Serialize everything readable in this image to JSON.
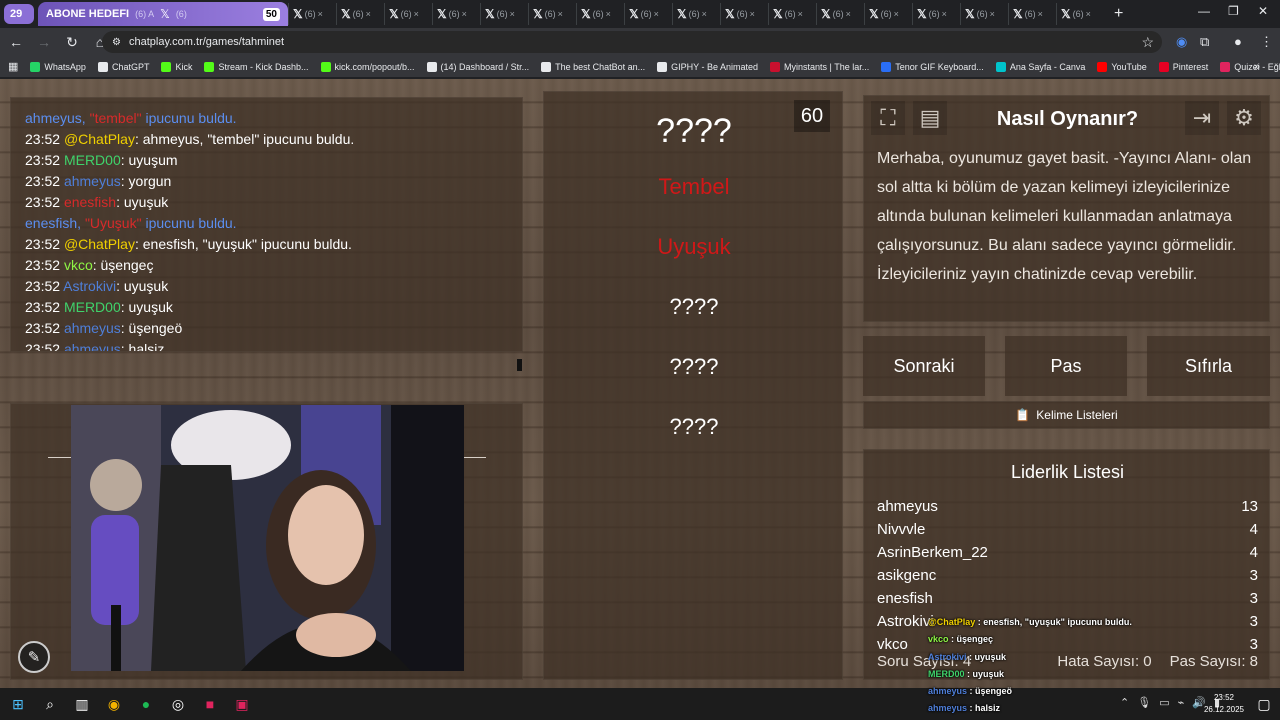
{
  "browser": {
    "tab_count": "29",
    "active_tab": {
      "title": "ABONE HEDEFI",
      "subtitle": "(6) A",
      "number": "50"
    },
    "other_tabs_label": "(6)",
    "other_tabs_count": 17,
    "url": "chatplay.com.tr/games/tahminet",
    "bookmarks": [
      {
        "label": "WhatsApp",
        "color": "#25d366"
      },
      {
        "label": "ChatGPT",
        "color": "#e8eaed"
      },
      {
        "label": "Kick",
        "color": "#53fc18"
      },
      {
        "label": "Stream - Kick Dashb...",
        "color": "#53fc18"
      },
      {
        "label": "kick.com/popout/b...",
        "color": "#53fc18"
      },
      {
        "label": "(14) Dashboard / Str...",
        "color": "#e8eaed"
      },
      {
        "label": "The best ChatBot an...",
        "color": "#e8eaed"
      },
      {
        "label": "GIPHY - Be Animated",
        "color": "#e8eaed"
      },
      {
        "label": "Myinstants | The lar...",
        "color": "#c8102e"
      },
      {
        "label": "Tenor GIF Keyboard...",
        "color": "#2a6ef5"
      },
      {
        "label": "Ana Sayfa - Canva",
        "color": "#00c4cc"
      },
      {
        "label": "YouTube",
        "color": "#ff0000"
      },
      {
        "label": "Pinterest",
        "color": "#e60023"
      },
      {
        "label": "Quizei - Eğlenceli ve...",
        "color": "#e0245e"
      }
    ]
  },
  "chat": {
    "lines": [
      {
        "type": "system",
        "pre": "ahmeyus, ",
        "hl": "\"tembel\"",
        "post": " ipucunu buldu."
      },
      {
        "type": "msg",
        "time": "23:52",
        "user": "@ChatPlay",
        "color": "#f0d000",
        "text": ": ahmeyus, \"tembel\" ipucunu buldu."
      },
      {
        "type": "msg",
        "time": "23:52",
        "user": "MERD00",
        "color": "#3fd36b",
        "text": ": uyuşum"
      },
      {
        "type": "msg",
        "time": "23:52",
        "user": "ahmeyus",
        "color": "#4f7fd9",
        "text": ": yorgun"
      },
      {
        "type": "msg",
        "time": "23:52",
        "user": "enesfish",
        "color": "#d72a2a",
        "text": ": uyuşuk"
      },
      {
        "type": "system",
        "pre": "enesfish, ",
        "hl": "\"Uyuşuk\"",
        "post": " ipucunu buldu."
      },
      {
        "type": "msg",
        "time": "23:52",
        "user": "@ChatPlay",
        "color": "#f0d000",
        "text": ": enesfish, \"uyuşuk\" ipucunu buldu."
      },
      {
        "type": "msg",
        "time": "23:52",
        "user": "vkco",
        "color": "#8ef545",
        "text": ": üşengeç"
      },
      {
        "type": "msg",
        "time": "23:52",
        "user": "Astrokivi",
        "color": "#4f7fd9",
        "text": ": uyuşuk"
      },
      {
        "type": "msg",
        "time": "23:52",
        "user": "MERD00",
        "color": "#3fd36b",
        "text": ": uyuşuk"
      },
      {
        "type": "msg",
        "time": "23:52",
        "user": "ahmeyus",
        "color": "#4f7fd9",
        "text": ": üşengeö"
      },
      {
        "type": "msg",
        "time": "23:52",
        "user": "ahmeyus",
        "color": "#4f7fd9",
        "text": ": halsiz"
      }
    ]
  },
  "game": {
    "timer": "60",
    "words": [
      {
        "text": "????",
        "state": "hidden",
        "big": true
      },
      {
        "text": "Tembel",
        "state": "found",
        "big": false
      },
      {
        "text": "Uyuşuk",
        "state": "found",
        "big": false
      },
      {
        "text": "????",
        "state": "hidden",
        "big": false
      },
      {
        "text": "????",
        "state": "hidden",
        "big": false
      },
      {
        "text": "????",
        "state": "hidden",
        "big": false
      }
    ]
  },
  "howto": {
    "title": "Nasıl Oynanır?",
    "text": "Merhaba, oyunumuz gayet basit. -Yayıncı Alanı- olan sol altta ki bölüm de yazan kelimeyi izleyicilerinize altında bulunan kelimeleri kullanmadan anlatmaya çalışıyorsunuz. Bu alanı sadece yayıncı görmelidir. İzleyicileriniz yayın chatinizde cevap verebilir."
  },
  "buttons": {
    "next": "Sonraki",
    "pass": "Pas",
    "reset": "Sıfırla",
    "word_lists": "Kelime Listeleri"
  },
  "leaderboard": {
    "title": "Liderlik Listesi",
    "rows": [
      {
        "name": "ahmeyus",
        "score": "13"
      },
      {
        "name": "Nivvvle",
        "score": "4"
      },
      {
        "name": "AsrinBerkem_22",
        "score": "4"
      },
      {
        "name": "asikgenc",
        "score": "3"
      },
      {
        "name": "enesfish",
        "score": "3"
      },
      {
        "name": "Astrokivi",
        "score": "3"
      },
      {
        "name": "vkco",
        "score": "3"
      }
    ],
    "question_count": "Soru Sayısı: 4",
    "error_count": "Hata Sayısı: 0",
    "pass_count": "Pas Sayısı: 8"
  },
  "overlay_chat": [
    {
      "user": "@ChatPlay",
      "color": "#f0d000",
      "text": " : enesfish, \"uyuşuk\" ipucunu buldu."
    },
    {
      "user": "vkco",
      "color": "#8ef545",
      "text": " : üşengeç"
    },
    {
      "user": "Astrokivi",
      "color": "#4f7fd9",
      "text": " : uyuşuk"
    },
    {
      "user": "MERD00",
      "color": "#3fd36b",
      "text": " : uyuşuk"
    },
    {
      "user": "ahmeyus",
      "color": "#4f7fd9",
      "text": " : üşengeö"
    },
    {
      "user": "ahmeyus",
      "color": "#4f7fd9",
      "text": " : halsiz"
    }
  ],
  "taskbar": {
    "time": "23:52",
    "date": "26.12.2025"
  }
}
